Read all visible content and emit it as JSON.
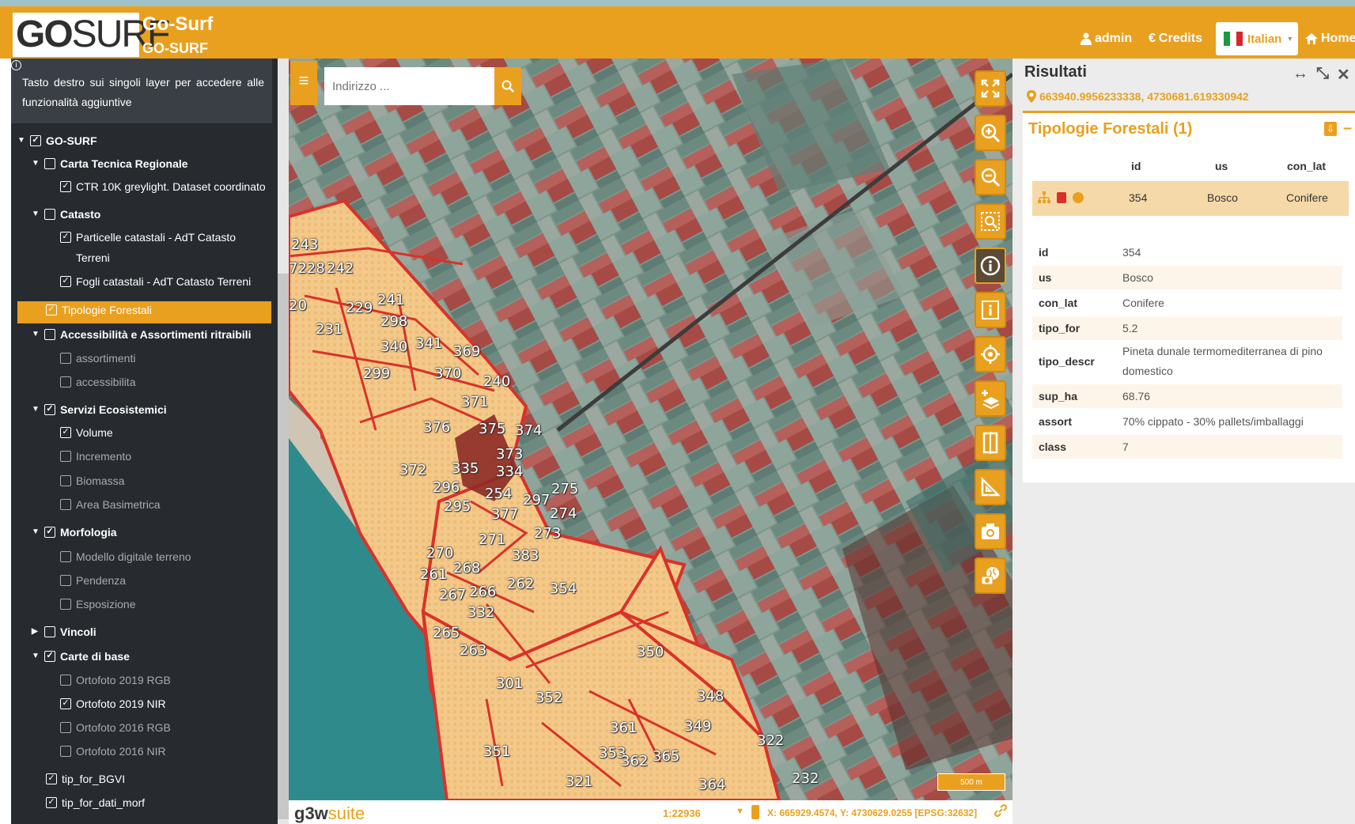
{
  "header": {
    "logo_bold": "GO",
    "logo_light": "SURF",
    "title": "Go-Surf",
    "subtitle": "GO-SURF",
    "admin_label": "admin",
    "credits_label": "Credits",
    "language_label": "Italian",
    "home_label": "Home",
    "accent_color": "#e9a01f"
  },
  "sidebar": {
    "info_text": "Tasto destro sui singoli layer per accedere alle funzionalità aggiuntive",
    "tree": [
      {
        "label": "GO-SURF",
        "checked": true,
        "group": true
      },
      {
        "label": "Carta Tecnica Regionale",
        "checked": false,
        "group": true
      },
      {
        "label": "CTR 10K greylight. Dataset coordinato",
        "checked": true
      },
      {
        "label": "Catasto",
        "checked": false,
        "group": true
      },
      {
        "label": "Particelle catastali - AdT Catasto Terreni",
        "checked": true
      },
      {
        "label": "Fogli catastali - AdT Catasto Terreni",
        "checked": true
      },
      {
        "label": "Tipologie Forestali",
        "checked": true,
        "selected": true
      },
      {
        "label": "Accessibilità e Assortimenti ritraibili",
        "checked": false,
        "group": true
      },
      {
        "label": "assortimenti",
        "checked": false
      },
      {
        "label": "accessibilita",
        "checked": false
      },
      {
        "label": "Servizi Ecosistemici",
        "checked": true,
        "group": true
      },
      {
        "label": "Volume",
        "checked": true
      },
      {
        "label": "Incremento",
        "checked": false
      },
      {
        "label": "Biomassa",
        "checked": false
      },
      {
        "label": "Area Basimetrica",
        "checked": false
      },
      {
        "label": "Morfologia",
        "checked": true,
        "group": true
      },
      {
        "label": "Modello digitale terreno",
        "checked": false
      },
      {
        "label": "Pendenza",
        "checked": false
      },
      {
        "label": "Esposizione",
        "checked": false
      },
      {
        "label": "Vincoli",
        "checked": false,
        "group": true,
        "collapsed": true
      },
      {
        "label": "Carte di base",
        "checked": true,
        "group": true
      },
      {
        "label": "Ortofoto 2019 RGB",
        "checked": false
      },
      {
        "label": "Ortofoto 2019 NIR",
        "checked": true
      },
      {
        "label": "Ortofoto 2016 RGB",
        "checked": false
      },
      {
        "label": "Ortofoto 2016 NIR",
        "checked": false
      },
      {
        "label": "tip_for_BGVI",
        "checked": true
      },
      {
        "label": "tip_for_dati_morf",
        "checked": true
      }
    ]
  },
  "map": {
    "search_placeholder": "Indirizzo ...",
    "scale_bar_label": "500 m",
    "scale_label": "1:22936",
    "coordinates_label": "X: 665929.4574, Y: 4730629.0255 [EPSG:32632]",
    "footer_logo_bold": "g3w",
    "footer_logo_light": "suite",
    "parcel_labels": [
      "243",
      "7228",
      "242",
      "20",
      "229",
      "241",
      "231",
      "298",
      "340",
      "341",
      "369",
      "299",
      "370",
      "240",
      "371",
      "376",
      "375",
      "374",
      "373",
      "372",
      "335",
      "334",
      "296",
      "254",
      "275",
      "295",
      "377",
      "297",
      "274",
      "273",
      "271",
      "270",
      "383",
      "268",
      "261",
      "262",
      "267",
      "266",
      "354",
      "332",
      "265",
      "263",
      "350",
      "301",
      "352",
      "348",
      "361",
      "349",
      "322",
      "351",
      "353",
      "362",
      "365",
      "321",
      "364",
      "232"
    ]
  },
  "results": {
    "title": "Risultati",
    "coordinates": "663940.9956233338, 4730681.619330942",
    "layer_title": "Tipologie Forestali (1)",
    "columns": [
      "id",
      "us",
      "con_lat"
    ],
    "row": [
      "354",
      "Bosco",
      "Conifere"
    ],
    "attributes": [
      {
        "key": "id",
        "value": "354"
      },
      {
        "key": "us",
        "value": "Bosco"
      },
      {
        "key": "con_lat",
        "value": "Conifere"
      },
      {
        "key": "tipo_for",
        "value": "5.2"
      },
      {
        "key": "tipo_descr",
        "value": "Pineta dunale termomediterranea di pino domestico"
      },
      {
        "key": "sup_ha",
        "value": "68.76"
      },
      {
        "key": "assort",
        "value": "70% cippato - 30% pallets/imballaggi"
      },
      {
        "key": "class",
        "value": "7"
      }
    ]
  }
}
